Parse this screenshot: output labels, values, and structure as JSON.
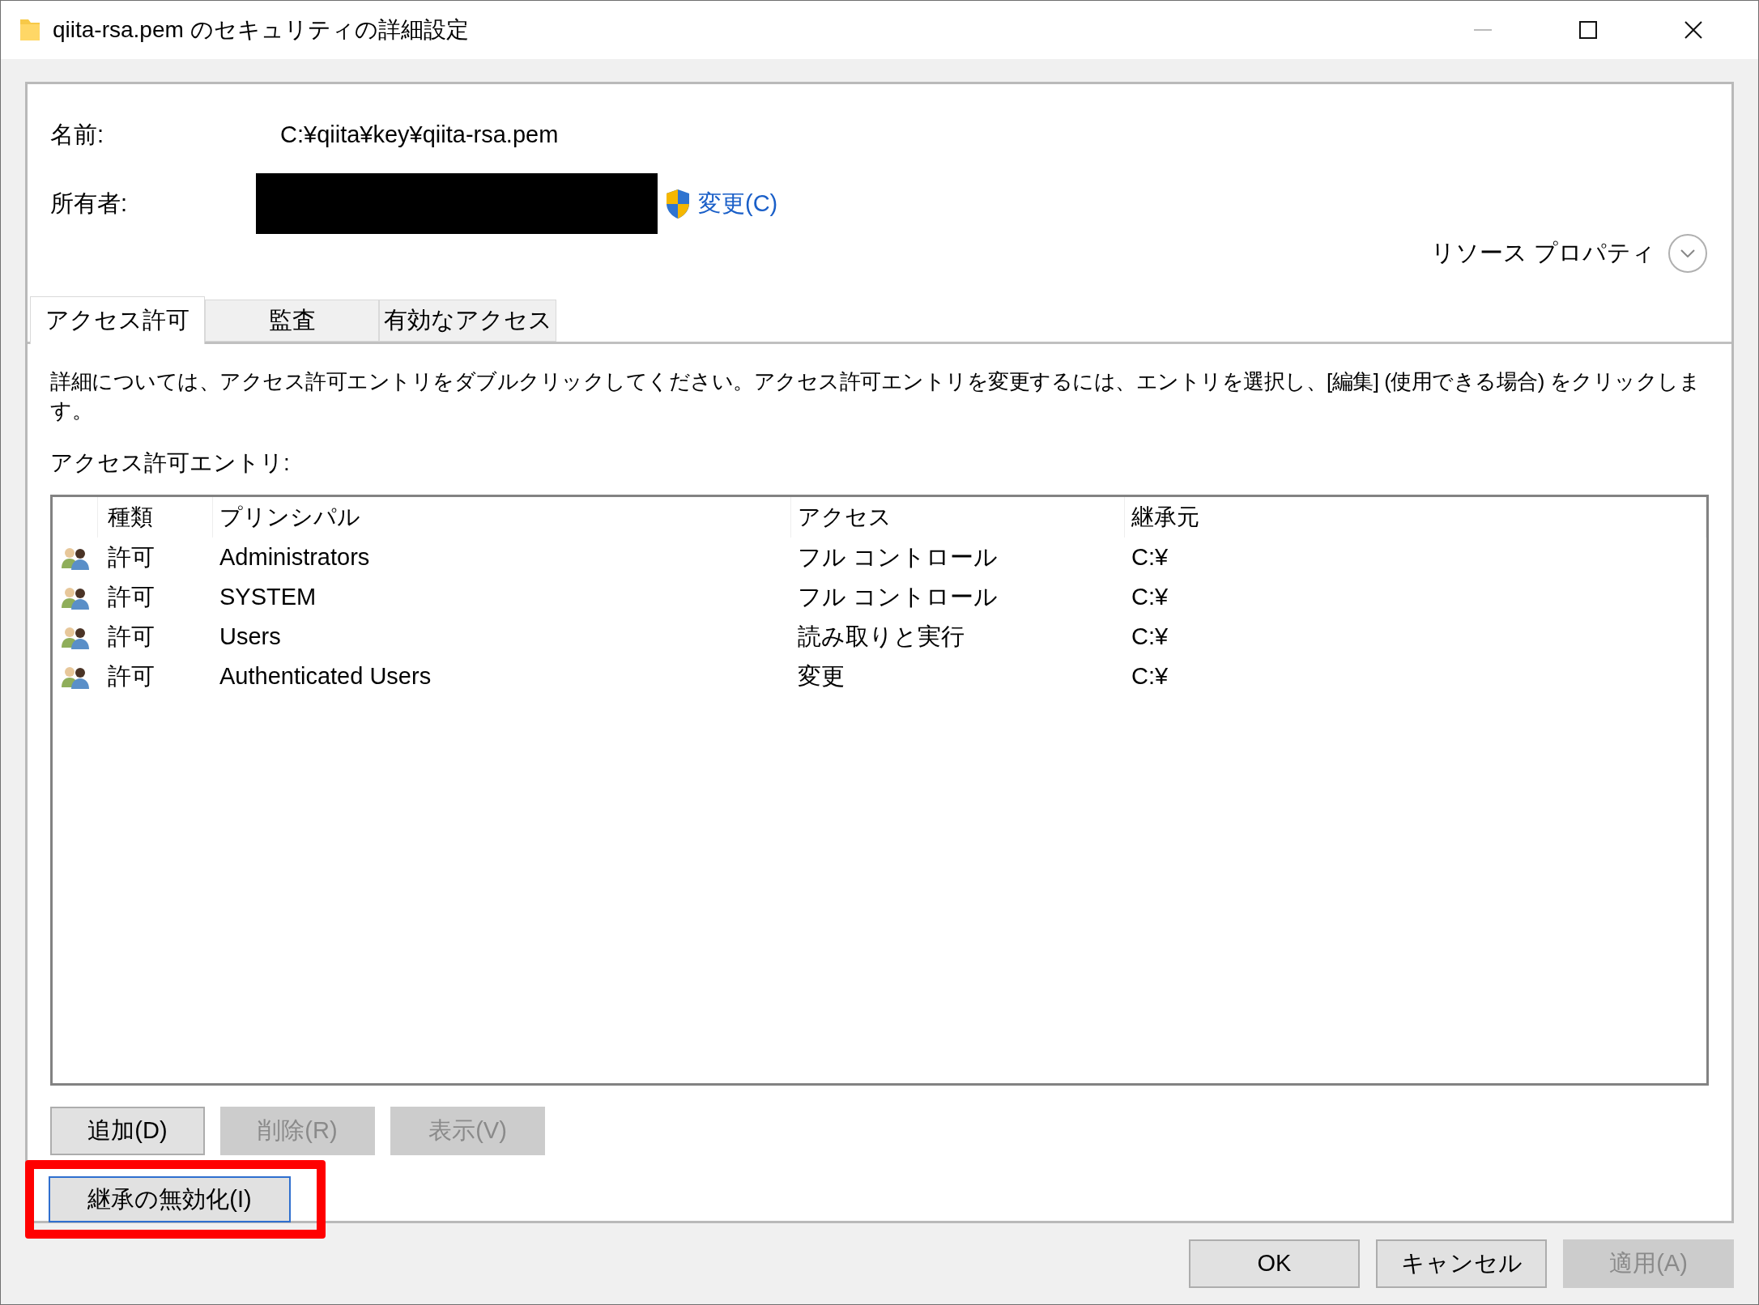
{
  "window": {
    "title": "qiita-rsa.pem のセキュリティの詳細設定"
  },
  "name_row": {
    "label": "名前:",
    "value": "C:¥qiita¥key¥qiita-rsa.pem"
  },
  "owner": {
    "label": "所有者:",
    "redacted": true,
    "change_link": "変更(C)"
  },
  "resource_properties": {
    "label": "リソース プロパティ",
    "expanded": false
  },
  "tabs": [
    {
      "label": "アクセス許可",
      "selected": true
    },
    {
      "label": "監査",
      "selected": false
    },
    {
      "label": "有効なアクセス",
      "selected": false
    }
  ],
  "description": "詳細については、アクセス許可エントリをダブルクリックしてください。アクセス許可エントリを変更するには、エントリを選択し、[編集] (使用できる場合) をクリックします。",
  "entries_label": "アクセス許可エントリ:",
  "table": {
    "columns": [
      "種類",
      "プリンシパル",
      "アクセス",
      "継承元"
    ],
    "rows": [
      {
        "type": "許可",
        "principal": "Administrators",
        "access": "フル コントロール",
        "inherited_from": "C:¥"
      },
      {
        "type": "許可",
        "principal": "SYSTEM",
        "access": "フル コントロール",
        "inherited_from": "C:¥"
      },
      {
        "type": "許可",
        "principal": "Users",
        "access": "読み取りと実行",
        "inherited_from": "C:¥"
      },
      {
        "type": "許可",
        "principal": "Authenticated Users",
        "access": "変更",
        "inherited_from": "C:¥"
      }
    ]
  },
  "entry_buttons": [
    {
      "label": "追加(D)",
      "disabled": false
    },
    {
      "label": "削除(R)",
      "disabled": true
    },
    {
      "label": "表示(V)",
      "disabled": true
    }
  ],
  "inheritance_button": {
    "label": "継承の無効化(I)",
    "focused": true,
    "highlighted": true
  },
  "dialog_buttons": [
    {
      "label": "OK",
      "disabled": false
    },
    {
      "label": "キャンセル",
      "disabled": false
    },
    {
      "label": "適用(A)",
      "disabled": true
    }
  ]
}
